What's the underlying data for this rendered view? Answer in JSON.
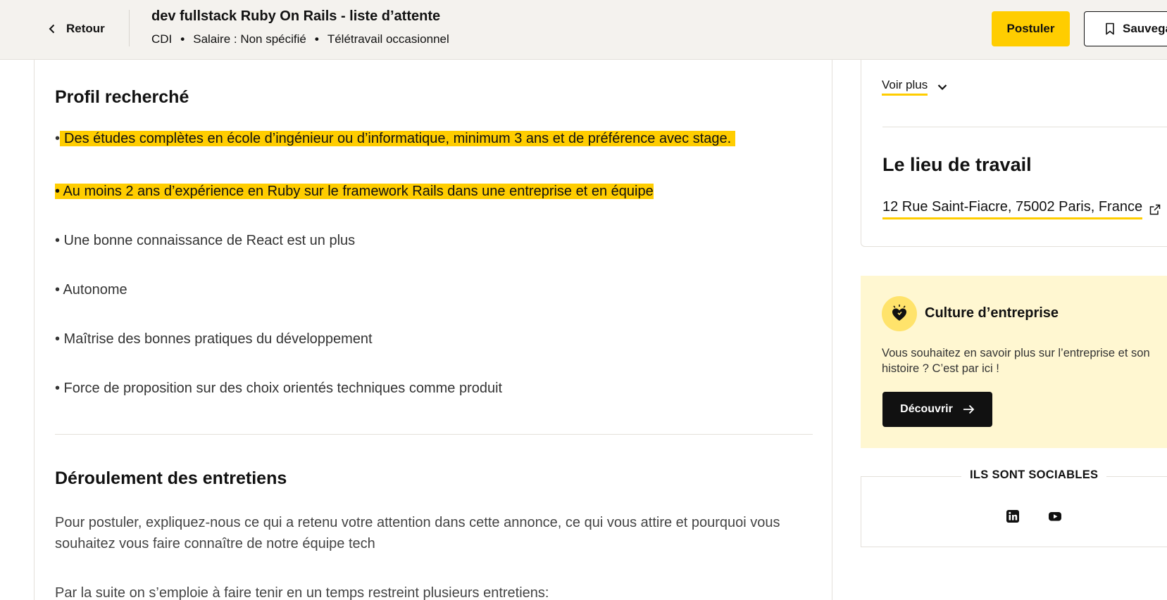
{
  "topbar": {
    "back_label": "Retour",
    "job_title": "dev fullstack Ruby On Rails - liste d’attente",
    "meta": [
      "CDI",
      "Salaire : Non spécifié",
      "Télétravail occasionnel"
    ],
    "meta_separator": "•",
    "apply_label": "Postuler",
    "save_label": "Sauvegarder"
  },
  "profile": {
    "title": "Profil recherché",
    "bullets": [
      "• Des études complètes en école d’ingénieur ou d’informatique, minimum 3 ans et de préférence avec stage.",
      "• Au moins 2 ans d’expérience en Ruby sur le framework Rails dans une entreprise et en équipe",
      "• Une bonne connaissance de React est un plus",
      "• Autonome",
      "• Maîtrise des bonnes pratiques du développement",
      "• Force de proposition sur des choix orientés techniques comme produit"
    ],
    "bullet_prefix": "•",
    "bullet_0_text": "Des études complètes en école d’ingénieur ou d’informatique, minimum 3 ans et de préférence avec stage."
  },
  "interviews": {
    "title": "Déroulement des entretiens",
    "paragraph_1": "Pour postuler, expliquez-nous ce qui a retenu votre attention dans cette annonce, ce qui vous attire et pourquoi vous souhaitez vous faire connaître de notre équipe tech",
    "paragraph_2": "Par la suite on s’emploie à faire tenir en un temps restreint plusieurs entretiens:"
  },
  "sidebar": {
    "voir_plus": "Voir plus",
    "lieu_title": "Le lieu de travail",
    "address": "12 Rue Saint-Fiacre, 75002 Paris, France",
    "culture": {
      "title": "Culture d’entreprise",
      "text": "Vous souhaitez en savoir plus sur l’entreprise et son histoire ? C’est par ici !",
      "button": "Découvrir"
    },
    "social": {
      "title": "ILS SONT SOCIABLES",
      "icons": [
        "linkedin-icon",
        "youtube-icon"
      ]
    }
  },
  "colors": {
    "accent": "#ffcd00",
    "topbar_bg": "#f4f2ee",
    "culture_bg": "#fff7d1",
    "dark": "#111111"
  }
}
